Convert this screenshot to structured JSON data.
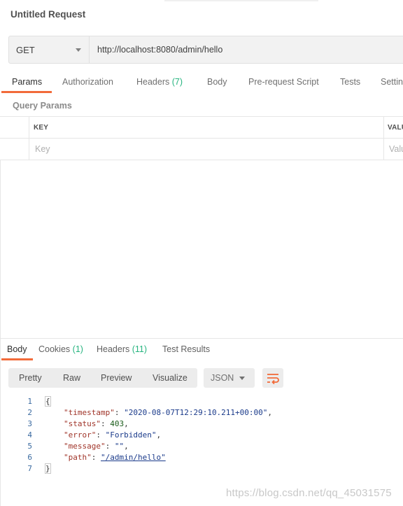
{
  "request": {
    "title": "Untitled Request",
    "method": "GET",
    "url": "http://localhost:8080/admin/hello"
  },
  "request_tabs": [
    {
      "label": "Params",
      "count": ""
    },
    {
      "label": "Authorization",
      "count": ""
    },
    {
      "label": "Headers",
      "count": "(7)"
    },
    {
      "label": "Body",
      "count": ""
    },
    {
      "label": "Pre-request Script",
      "count": ""
    },
    {
      "label": "Tests",
      "count": ""
    },
    {
      "label": "Settin",
      "count": ""
    }
  ],
  "query_params": {
    "section_label": "Query Params",
    "columns": [
      "KEY",
      "VALU"
    ],
    "placeholders": [
      "Key",
      "Valu"
    ]
  },
  "response_tabs": [
    {
      "label": "Body",
      "count": ""
    },
    {
      "label": "Cookies",
      "count": "(1)"
    },
    {
      "label": "Headers",
      "count": "(11)"
    },
    {
      "label": "Test Results",
      "count": ""
    }
  ],
  "response_toolbar": {
    "views": [
      "Pretty",
      "Raw",
      "Preview",
      "Visualize"
    ],
    "format": "JSON",
    "wrap_icon": "wrap-lines-icon"
  },
  "response_body": {
    "line_numbers": [
      "1",
      "2",
      "3",
      "4",
      "5",
      "6",
      "7"
    ],
    "open_brace": "{",
    "close_brace": "}",
    "fields": [
      {
        "key": "\"timestamp\"",
        "value": "\"2020-08-07T12:29:10.211+00:00\"",
        "type": "string",
        "trail": ","
      },
      {
        "key": "\"status\"",
        "value": "403",
        "type": "number",
        "trail": ","
      },
      {
        "key": "\"error\"",
        "value": "\"Forbidden\"",
        "type": "string",
        "trail": ","
      },
      {
        "key": "\"message\"",
        "value": "\"\"",
        "type": "string",
        "trail": ","
      },
      {
        "key": "\"path\"",
        "value": "\"/admin/hello\"",
        "type": "link",
        "trail": ""
      }
    ]
  },
  "watermark": "https://blog.csdn.net/qq_45031575",
  "colors": {
    "accent": "#f26b3a",
    "count": "#26b47f",
    "json_key": "#a0352a",
    "json_string": "#1a3a8a",
    "json_number": "#1a5c1a"
  }
}
